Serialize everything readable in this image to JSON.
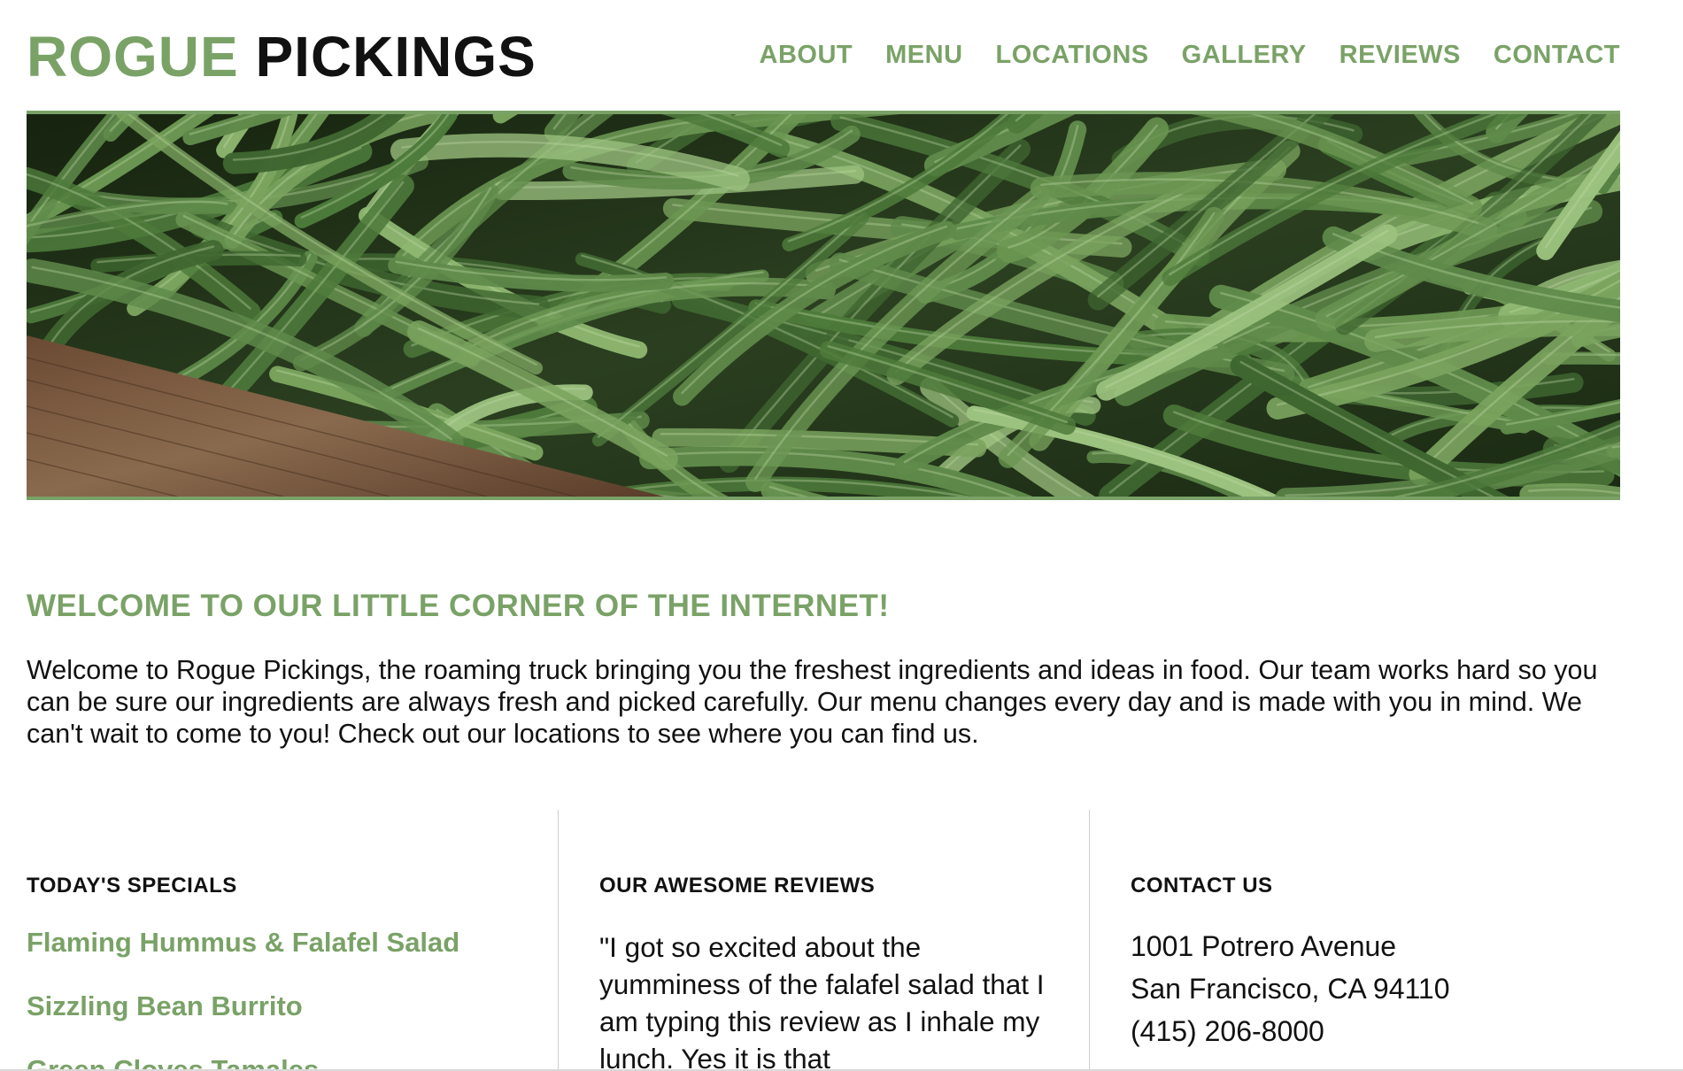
{
  "header": {
    "logo_accent": "ROGUE",
    "logo_rest": "PICKINGS",
    "nav": [
      "ABOUT",
      "MENU",
      "LOCATIONS",
      "GALLERY",
      "REVIEWS",
      "CONTACT"
    ]
  },
  "colors": {
    "accent": "#7aa267",
    "text": "#111111"
  },
  "welcome": {
    "title": "WELCOME TO OUR LITTLE CORNER OF THE INTERNET!",
    "body": "Welcome to Rogue Pickings, the roaming truck bringing you the freshest ingredients and ideas in food. Our team works hard so you can be sure our ingredients are always fresh and picked carefully. Our menu changes every day and is made with you in mind. We can't wait to come to you! Check out our locations to see where you can find us."
  },
  "specials": {
    "title": "TODAY'S SPECIALS",
    "items": [
      "Flaming Hummus & Falafel Salad",
      "Sizzling Bean Burrito",
      "Green Cloves Tamales"
    ]
  },
  "reviews": {
    "title": "OUR AWESOME REVIEWS",
    "text": "\"I got so excited about the yumminess of the falafel salad that I am typing this review as I inhale my lunch. Yes it is that"
  },
  "contact": {
    "title": "CONTACT US",
    "address1": "1001 Potrero Avenue",
    "address2": "San Francisco, CA 94110",
    "phone": "(415) 206-8000"
  }
}
